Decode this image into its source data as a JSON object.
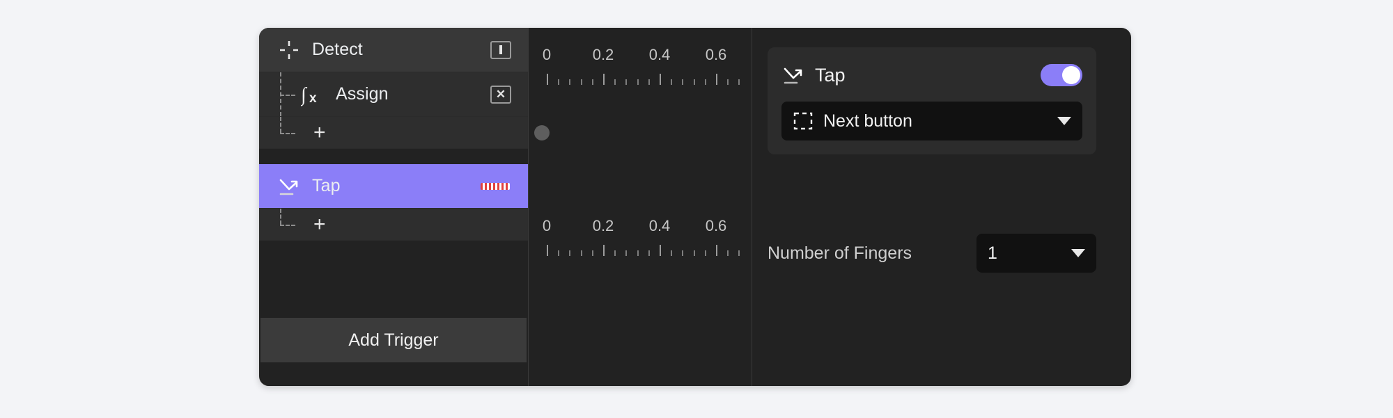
{
  "panel": {
    "background_color": "#222222",
    "accent_color": "#8b7ef8"
  },
  "tracks": {
    "rows": [
      {
        "id": "detect",
        "label": "Detect",
        "icon": "crosshair-icon",
        "badge": "marker-bar-badge",
        "selected": false,
        "depth": 0
      },
      {
        "id": "assign",
        "label": "Assign",
        "icon": "function-fx-icon",
        "badge": "close-x-badge",
        "selected": false,
        "depth": 1
      },
      {
        "id": "add-child-1",
        "label": "+",
        "icon": "plus-icon",
        "selected": false,
        "depth": 1
      },
      {
        "id": "tap",
        "label": "Tap",
        "icon": "tap-arrow-icon",
        "badge": "striped-chip",
        "selected": true,
        "depth": 0
      },
      {
        "id": "add-child-2",
        "label": "+",
        "icon": "plus-icon",
        "selected": false,
        "depth": 1
      }
    ],
    "add_trigger_label": "Add Trigger"
  },
  "timeline": {
    "rulers": [
      {
        "id": "ruler-top",
        "labels": [
          "0",
          "0.2",
          "0.4",
          "0.6"
        ],
        "values": [
          0,
          0.2,
          0.4,
          0.6
        ]
      },
      {
        "id": "ruler-bottom",
        "labels": [
          "0",
          "0.2",
          "0.4",
          "0.6"
        ],
        "values": [
          0,
          0.2,
          0.4,
          0.6
        ]
      }
    ],
    "keyframes": [
      {
        "id": "assign-keyframe",
        "time": 0.0,
        "shape": "circle",
        "color": "#5e5e5e"
      }
    ]
  },
  "properties": {
    "card": {
      "title": "Tap",
      "icon": "tap-arrow-icon",
      "enabled": true,
      "target_select": {
        "icon": "dashed-selection-icon",
        "value": "Next button"
      }
    },
    "fingers": {
      "label": "Number of Fingers",
      "value": "1"
    }
  }
}
